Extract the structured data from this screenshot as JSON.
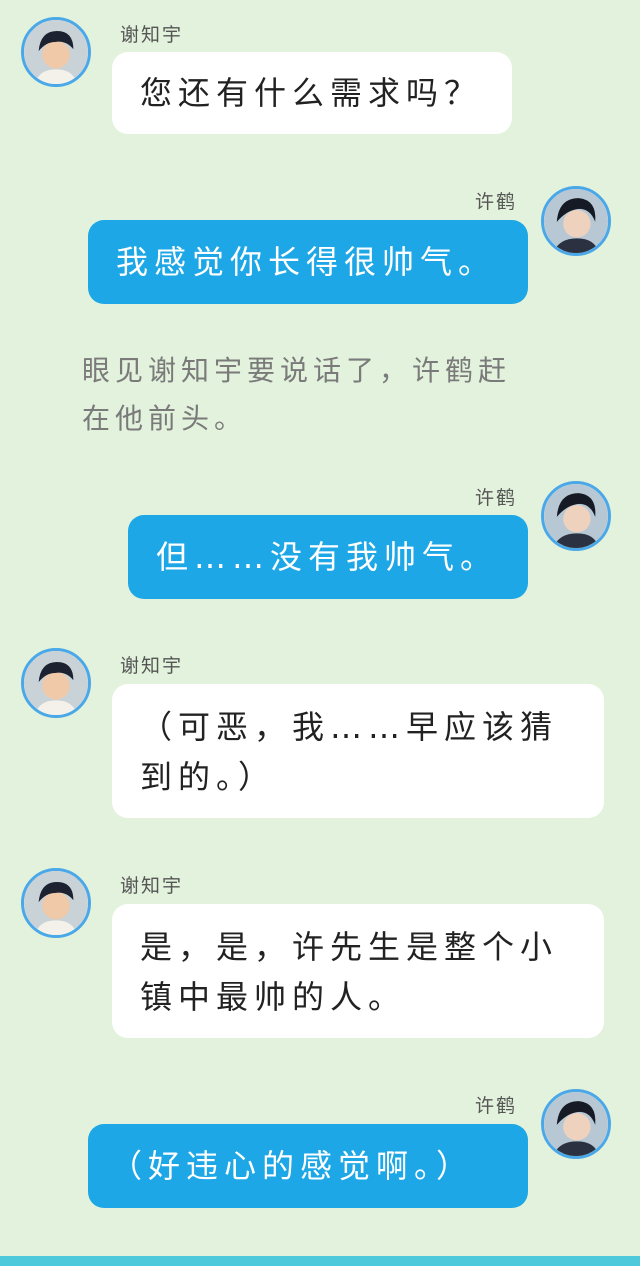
{
  "characters": {
    "xie": {
      "name": "谢知宇"
    },
    "xu": {
      "name": "许鹤"
    }
  },
  "messages": [
    {
      "speaker": "谢知宇",
      "text": "您还有什么需求吗？"
    },
    {
      "speaker": "许鹤",
      "text": "我感觉你长得很帅气。"
    },
    {
      "speaker": "许鹤",
      "text": "但……没有我帅气。"
    },
    {
      "speaker": "谢知宇",
      "text": "（可恶，我……早应该猜到的。）"
    },
    {
      "speaker": "谢知宇",
      "text": "是，是，许先生是整个小镇中最帅的人。"
    },
    {
      "speaker": "许鹤",
      "text": "（好违心的感觉啊。）"
    }
  ],
  "narration": "眼见谢知宇要说话了，许鹤赶在他前头。",
  "colors": {
    "background": "#e3f2dc",
    "left_bubble": "#ffffff",
    "right_bubble": "#1ea7e6",
    "avatar_ring": "#4aa8e8",
    "bottom_bar": "#4ec9db"
  }
}
